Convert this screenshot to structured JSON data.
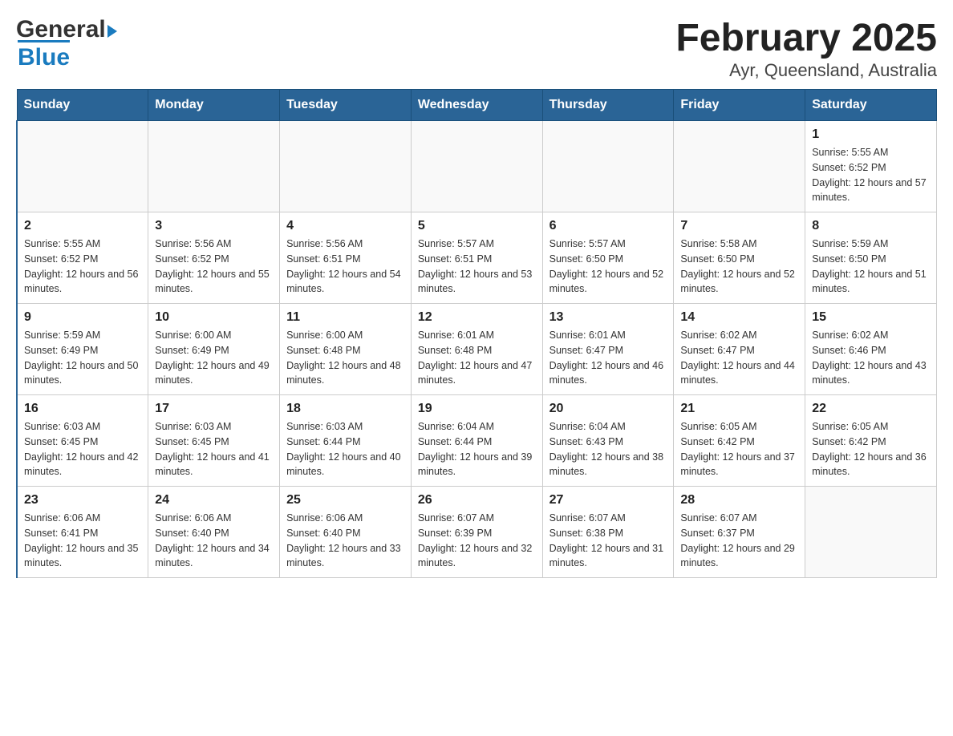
{
  "header": {
    "logo_general": "General",
    "logo_blue": "Blue",
    "title": "February 2025",
    "subtitle": "Ayr, Queensland, Australia"
  },
  "days_of_week": [
    "Sunday",
    "Monday",
    "Tuesday",
    "Wednesday",
    "Thursday",
    "Friday",
    "Saturday"
  ],
  "weeks": [
    [
      {
        "day": "",
        "info": ""
      },
      {
        "day": "",
        "info": ""
      },
      {
        "day": "",
        "info": ""
      },
      {
        "day": "",
        "info": ""
      },
      {
        "day": "",
        "info": ""
      },
      {
        "day": "",
        "info": ""
      },
      {
        "day": "1",
        "info": "Sunrise: 5:55 AM\nSunset: 6:52 PM\nDaylight: 12 hours and 57 minutes."
      }
    ],
    [
      {
        "day": "2",
        "info": "Sunrise: 5:55 AM\nSunset: 6:52 PM\nDaylight: 12 hours and 56 minutes."
      },
      {
        "day": "3",
        "info": "Sunrise: 5:56 AM\nSunset: 6:52 PM\nDaylight: 12 hours and 55 minutes."
      },
      {
        "day": "4",
        "info": "Sunrise: 5:56 AM\nSunset: 6:51 PM\nDaylight: 12 hours and 54 minutes."
      },
      {
        "day": "5",
        "info": "Sunrise: 5:57 AM\nSunset: 6:51 PM\nDaylight: 12 hours and 53 minutes."
      },
      {
        "day": "6",
        "info": "Sunrise: 5:57 AM\nSunset: 6:50 PM\nDaylight: 12 hours and 52 minutes."
      },
      {
        "day": "7",
        "info": "Sunrise: 5:58 AM\nSunset: 6:50 PM\nDaylight: 12 hours and 52 minutes."
      },
      {
        "day": "8",
        "info": "Sunrise: 5:59 AM\nSunset: 6:50 PM\nDaylight: 12 hours and 51 minutes."
      }
    ],
    [
      {
        "day": "9",
        "info": "Sunrise: 5:59 AM\nSunset: 6:49 PM\nDaylight: 12 hours and 50 minutes."
      },
      {
        "day": "10",
        "info": "Sunrise: 6:00 AM\nSunset: 6:49 PM\nDaylight: 12 hours and 49 minutes."
      },
      {
        "day": "11",
        "info": "Sunrise: 6:00 AM\nSunset: 6:48 PM\nDaylight: 12 hours and 48 minutes."
      },
      {
        "day": "12",
        "info": "Sunrise: 6:01 AM\nSunset: 6:48 PM\nDaylight: 12 hours and 47 minutes."
      },
      {
        "day": "13",
        "info": "Sunrise: 6:01 AM\nSunset: 6:47 PM\nDaylight: 12 hours and 46 minutes."
      },
      {
        "day": "14",
        "info": "Sunrise: 6:02 AM\nSunset: 6:47 PM\nDaylight: 12 hours and 44 minutes."
      },
      {
        "day": "15",
        "info": "Sunrise: 6:02 AM\nSunset: 6:46 PM\nDaylight: 12 hours and 43 minutes."
      }
    ],
    [
      {
        "day": "16",
        "info": "Sunrise: 6:03 AM\nSunset: 6:45 PM\nDaylight: 12 hours and 42 minutes."
      },
      {
        "day": "17",
        "info": "Sunrise: 6:03 AM\nSunset: 6:45 PM\nDaylight: 12 hours and 41 minutes."
      },
      {
        "day": "18",
        "info": "Sunrise: 6:03 AM\nSunset: 6:44 PM\nDaylight: 12 hours and 40 minutes."
      },
      {
        "day": "19",
        "info": "Sunrise: 6:04 AM\nSunset: 6:44 PM\nDaylight: 12 hours and 39 minutes."
      },
      {
        "day": "20",
        "info": "Sunrise: 6:04 AM\nSunset: 6:43 PM\nDaylight: 12 hours and 38 minutes."
      },
      {
        "day": "21",
        "info": "Sunrise: 6:05 AM\nSunset: 6:42 PM\nDaylight: 12 hours and 37 minutes."
      },
      {
        "day": "22",
        "info": "Sunrise: 6:05 AM\nSunset: 6:42 PM\nDaylight: 12 hours and 36 minutes."
      }
    ],
    [
      {
        "day": "23",
        "info": "Sunrise: 6:06 AM\nSunset: 6:41 PM\nDaylight: 12 hours and 35 minutes."
      },
      {
        "day": "24",
        "info": "Sunrise: 6:06 AM\nSunset: 6:40 PM\nDaylight: 12 hours and 34 minutes."
      },
      {
        "day": "25",
        "info": "Sunrise: 6:06 AM\nSunset: 6:40 PM\nDaylight: 12 hours and 33 minutes."
      },
      {
        "day": "26",
        "info": "Sunrise: 6:07 AM\nSunset: 6:39 PM\nDaylight: 12 hours and 32 minutes."
      },
      {
        "day": "27",
        "info": "Sunrise: 6:07 AM\nSunset: 6:38 PM\nDaylight: 12 hours and 31 minutes."
      },
      {
        "day": "28",
        "info": "Sunrise: 6:07 AM\nSunset: 6:37 PM\nDaylight: 12 hours and 29 minutes."
      },
      {
        "day": "",
        "info": ""
      }
    ]
  ]
}
